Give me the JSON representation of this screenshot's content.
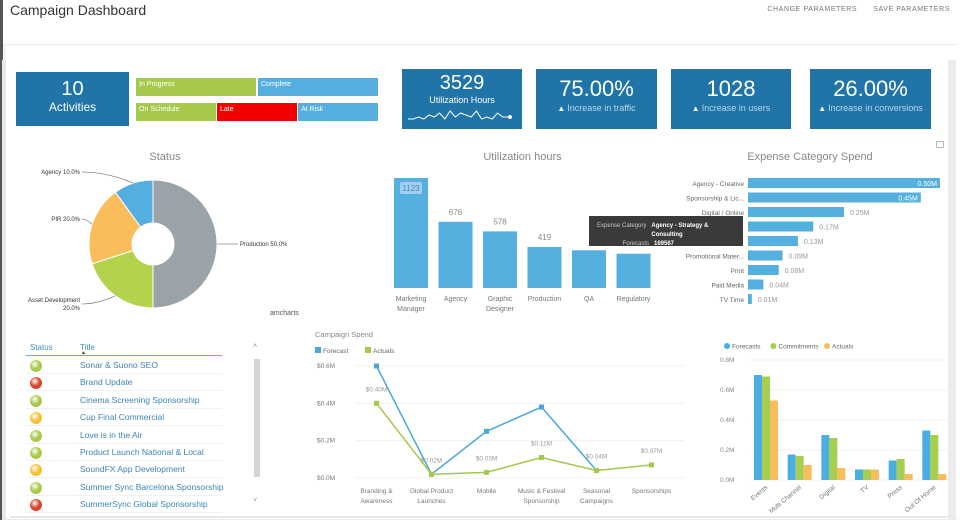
{
  "header": {
    "title": "Campaign Dashboard",
    "actions": [
      "CHANGE PARAMETERS",
      "SAVE PARAMETERS"
    ]
  },
  "kpis": {
    "activities": {
      "value": "10",
      "label": "Activities"
    },
    "utilization": {
      "value": "3529",
      "label": "Utilization Hours",
      "sparkline": [
        2,
        2,
        3,
        2,
        4,
        3,
        5,
        2,
        6,
        3,
        5,
        4,
        3,
        6,
        2,
        3,
        2,
        5,
        3,
        3
      ]
    },
    "traffic": {
      "value": "75.00%",
      "label": "Increase in traffic",
      "icon": "triangle-up-icon"
    },
    "users": {
      "value": "1028",
      "label": "Increase in users",
      "icon": "triangle-up-icon"
    },
    "conversions": {
      "value": "26.00%",
      "label": "Increase in conversions",
      "icon": "triangle-up-icon"
    }
  },
  "status_tags": {
    "in_progress": "In Progress",
    "complete": "Complete",
    "on_schedule": "On Schedule",
    "late": "Late",
    "at_risk": "At Risk"
  },
  "colors": {
    "kpi_blue": "#2074a8",
    "light_blue": "#55aee0",
    "green": "#a6c94b",
    "red": "#f50000",
    "orange": "#f9bd5c",
    "gray": "#9aa3a8"
  },
  "status_chart_title": "Status",
  "util_chart_title": "Utilization hours",
  "expense_chart_title": "Expense Category Spend",
  "campaign_chart_title": "Campaign Spend",
  "credit": "amcharts",
  "tooltip": {
    "rows": [
      {
        "key": "Expense Category",
        "value": "Agency - Strategy & Consulting"
      },
      {
        "key": "Forecasts",
        "value": "169567"
      }
    ]
  },
  "chart_data": [
    {
      "id": "status",
      "type": "pie",
      "title": "Status",
      "slices": [
        {
          "label": "Production",
          "value": 50.0,
          "text": "Production 50.0%",
          "color": "#9aa3a8"
        },
        {
          "label": "Asset Development",
          "value": 20.0,
          "text": "Asset Development 20.0%",
          "color": "#b4d34c"
        },
        {
          "label": "PIR",
          "value": 20.0,
          "text": "PIR 20.0%",
          "color": "#f9bd5c"
        },
        {
          "label": "Agency",
          "value": 10.0,
          "text": "Agency 10.0%",
          "color": "#55aee0"
        }
      ]
    },
    {
      "id": "utilization",
      "type": "bar",
      "title": "Utilization hours",
      "categories": [
        "Marketing Manager",
        "Agency",
        "Graphic Designer",
        "Production",
        "QA",
        "Regulatory"
      ],
      "values": [
        1123,
        676,
        578,
        419,
        385,
        350
      ],
      "labels": [
        "1123",
        "676",
        "578",
        "419",
        "",
        ""
      ],
      "ylim": [
        0,
        1123
      ]
    },
    {
      "id": "expense",
      "type": "bar",
      "orientation": "horizontal",
      "title": "Expense Category Spend",
      "categories": [
        "Agency - Creative",
        "Sponsorship & Lic...",
        "Digital / Online",
        "Agency - Strategy & Consulting",
        "",
        "Promotional Mater...",
        "Print",
        "Paid Media",
        "TV Time"
      ],
      "values": [
        0.5,
        0.45,
        0.25,
        0.17,
        0.13,
        0.09,
        0.08,
        0.04,
        0.01
      ],
      "labels": [
        "0.50M",
        "0.45M",
        "0.25M",
        "0.17M",
        "0.13M",
        "0.09M",
        "0.08M",
        "0.04M",
        "0.01M"
      ],
      "xlim": [
        0,
        0.5
      ]
    },
    {
      "id": "campaign",
      "type": "line",
      "title": "Campaign Spend",
      "categories": [
        "Branding & Awareness",
        "Global Product Launches",
        "Mobile",
        "Music & Festival Sponsorship",
        "Seasonal Campaigns",
        "Sponsorships"
      ],
      "series": [
        {
          "name": "Forecast",
          "color": "#4aa8d8",
          "values": [
            0.6,
            0.02,
            0.25,
            0.38,
            0.04,
            null
          ]
        },
        {
          "name": "Actuals",
          "color": "#a6c94b",
          "values": [
            0.4,
            0.02,
            0.03,
            0.11,
            0.04,
            0.07
          ],
          "labels": [
            "$0.40M",
            "$0.02M",
            "$0.03M",
            "$0.11M",
            "$0.04M",
            "$0.07M"
          ]
        }
      ],
      "yticks": [
        "$0.0M",
        "$0.2M",
        "$0.4M",
        "$0.6M"
      ],
      "ylim": [
        0,
        0.6
      ],
      "legend": "top-left"
    },
    {
      "id": "channel",
      "type": "bar",
      "title": "",
      "categories": [
        "Events",
        "Multi Channel",
        "Digital",
        "TV",
        "Press",
        "Out Of Home"
      ],
      "series": [
        {
          "name": "Forecasts",
          "color": "#4aaee2",
          "values": [
            0.7,
            0.17,
            0.3,
            0.07,
            0.13,
            0.33
          ]
        },
        {
          "name": "Commitments",
          "color": "#a6cf4f",
          "values": [
            0.69,
            0.16,
            0.28,
            0.07,
            0.14,
            0.3
          ]
        },
        {
          "name": "Actuals",
          "color": "#f9bd5c",
          "values": [
            0.53,
            0.1,
            0.08,
            0.07,
            0.04,
            0.04
          ]
        }
      ],
      "yticks": [
        "0.0M",
        "0.2M",
        "0.4M",
        "0.6M",
        "0.8M"
      ],
      "ylim": [
        0,
        0.8
      ],
      "legend": "top-left"
    }
  ],
  "activity_list": {
    "columns": [
      "Status",
      "Title"
    ],
    "rows": [
      {
        "status": "green",
        "title": "Sonar & Suono SEO"
      },
      {
        "status": "red",
        "title": "Brand Update"
      },
      {
        "status": "green",
        "title": "Cinema Screening Sponsorship"
      },
      {
        "status": "yellow",
        "title": "Cup Final Commercial"
      },
      {
        "status": "green",
        "title": "Love is in the Air"
      },
      {
        "status": "green",
        "title": "Product Launch National & Local"
      },
      {
        "status": "yellow",
        "title": "SoundFX App Development"
      },
      {
        "status": "green",
        "title": "Summer Sync Barcelona Sponsorship"
      },
      {
        "status": "red",
        "title": "SummerSync Global Sponsorship"
      }
    ],
    "status_colors": {
      "green": "#a9c94a",
      "red": "#d9452a",
      "yellow": "#f5c131"
    }
  }
}
